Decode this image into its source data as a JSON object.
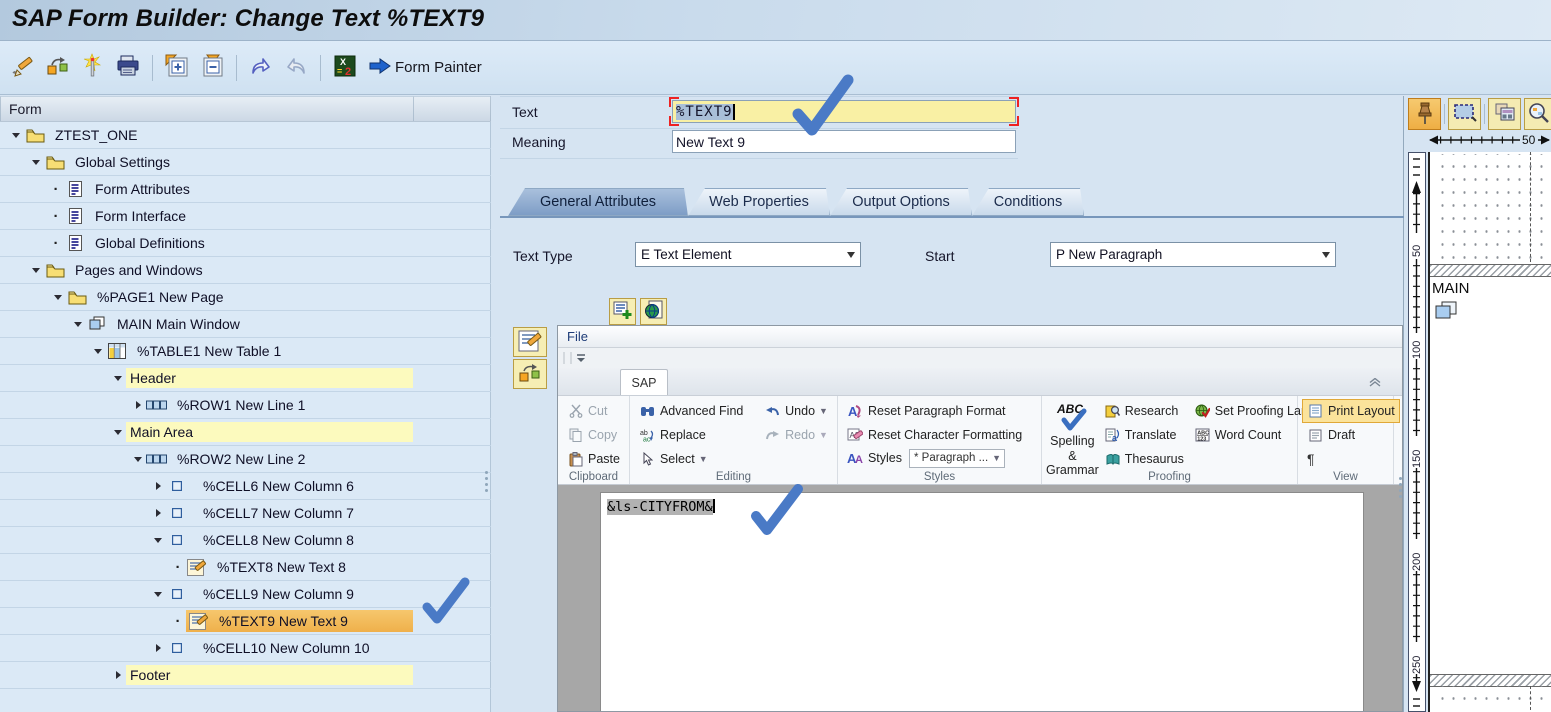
{
  "window": {
    "title": "SAP Form Builder: Change Text %TEXT9"
  },
  "toolbar": {
    "form_painter_label": "Form Painter",
    "icons": [
      "change-pencil-icon",
      "navigate-nodes-icon",
      "magic-wand-icon",
      "printer-icon",
      "expand-subtree-icon",
      "collapse-subtree-icon",
      "undo-icon",
      "redo-icon",
      "check-form-icon",
      "form-painter-arrow-icon"
    ]
  },
  "tree": {
    "header": "Form",
    "items": [
      {
        "label": "ZTEST_ONE",
        "icon": "folder-icon"
      },
      {
        "label": "Global Settings",
        "icon": "folder-icon"
      },
      {
        "label": "Form Attributes",
        "icon": "document-icon"
      },
      {
        "label": "Form Interface",
        "icon": "document-icon"
      },
      {
        "label": "Global Definitions",
        "icon": "document-icon"
      },
      {
        "label": "Pages and Windows",
        "icon": "folder-icon"
      },
      {
        "label": "%PAGE1 New Page",
        "icon": "folder-icon"
      },
      {
        "label": "MAIN Main Window",
        "icon": "window-icon"
      },
      {
        "label": "%TABLE1 New Table 1",
        "icon": "table-icon"
      },
      {
        "label": "Header",
        "icon": "none"
      },
      {
        "label": "%ROW1 New Line 1",
        "icon": "line-icon"
      },
      {
        "label": "Main Area",
        "icon": "none"
      },
      {
        "label": "%ROW2 New Line 2",
        "icon": "line-icon"
      },
      {
        "label": "%CELL6 New Column 6",
        "icon": "cell-icon"
      },
      {
        "label": "%CELL7 New Column 7",
        "icon": "cell-icon"
      },
      {
        "label": "%CELL8 New Column 8",
        "icon": "cell-icon"
      },
      {
        "label": "%TEXT8 New Text 8",
        "icon": "text-node-icon"
      },
      {
        "label": "%CELL9 New Column 9",
        "icon": "cell-icon"
      },
      {
        "label": "%TEXT9 New Text 9",
        "icon": "text-node-icon",
        "selected": true
      },
      {
        "label": "%CELL10 New Column 10",
        "icon": "cell-icon"
      },
      {
        "label": "Footer",
        "icon": "none"
      }
    ]
  },
  "fields": {
    "text_label": "Text",
    "text_value": "%TEXT9",
    "meaning_label": "Meaning",
    "meaning_value": "New Text 9"
  },
  "tabs": [
    {
      "label": "General Attributes",
      "active": true
    },
    {
      "label": "Web Properties",
      "active": false
    },
    {
      "label": "Output Options",
      "active": false
    },
    {
      "label": "Conditions",
      "active": false
    }
  ],
  "attributes": {
    "text_type_label": "Text Type",
    "text_type_value": "E Text Element",
    "start_label": "Start",
    "start_value": "P New Paragraph"
  },
  "editor": {
    "file_menu": "File",
    "ribbon_tab": "SAP",
    "ribbon": {
      "clipboard": {
        "title": "Clipboard",
        "cut": "Cut",
        "copy": "Copy",
        "paste": "Paste"
      },
      "editing": {
        "title": "Editing",
        "advanced_find": "Advanced Find",
        "replace": "Replace",
        "select": "Select",
        "undo": "Undo",
        "redo": "Redo"
      },
      "styles": {
        "title": "Styles",
        "reset_paragraph": "Reset Paragraph Format",
        "reset_character": "Reset Character Formatting",
        "styles": "Styles",
        "paragraph_dropdown": "* Paragraph ..."
      },
      "proofing": {
        "title": "Proofing",
        "spelling": "Spelling & Grammar",
        "research": "Research",
        "translate": "Translate",
        "thesaurus": "Thesaurus",
        "set_proofing_language": "Set Proofing Language",
        "word_count": "Word Count"
      },
      "view": {
        "title": "View",
        "print_layout": "Print Layout",
        "draft": "Draft",
        "pilcrow": "¶"
      }
    },
    "content": "&ls-CITYFROM&"
  },
  "preview": {
    "main_label": "MAIN",
    "h_ruler_label": "50",
    "v_ruler_labels": [
      "50",
      "100",
      "150",
      "200",
      "250"
    ]
  },
  "colors": {
    "selected_tree_row": "#f2b85c",
    "yellow_highlight_row": "#fcfabe",
    "text_field_highlight": "#f9f0a4",
    "annotation_check_blue": "#4a7ac6",
    "active_view_button": "#fbe39b",
    "focus_bracket_red": "#ee2222"
  }
}
